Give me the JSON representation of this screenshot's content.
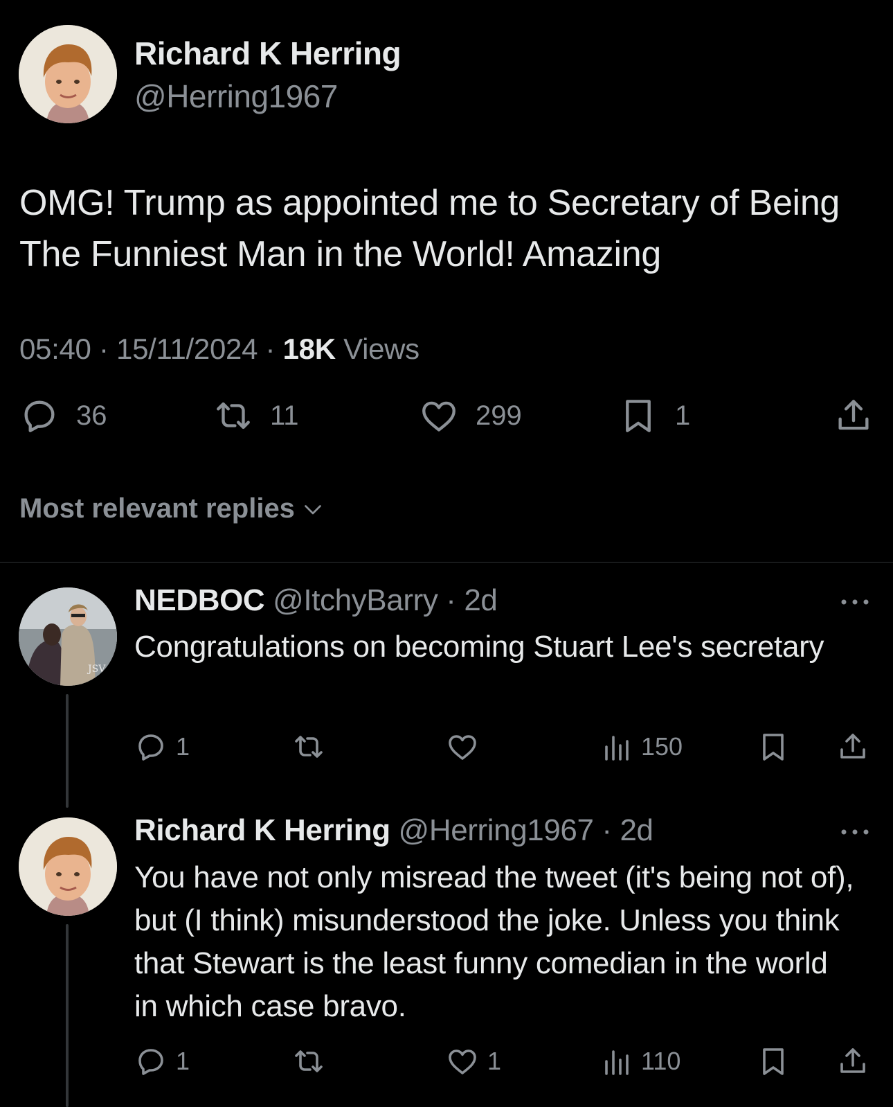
{
  "main_tweet": {
    "author_name": "Richard K Herring",
    "author_handle": "@Herring1967",
    "text": "OMG! Trump as appointed me to Secretary of Being The Funniest Man in the World! Amazing",
    "time": "05:40",
    "date": "15/11/2024",
    "views_count": "18K",
    "views_label": "Views",
    "replies": "36",
    "reposts": "11",
    "likes": "299",
    "bookmarks": "1"
  },
  "sort": {
    "label": "Most relevant replies"
  },
  "replies": [
    {
      "author_name": "NEDBOC",
      "author_handle": "@ItchyBarry",
      "age": "2d",
      "text": "Congratulations on becoming Stuart Lee's secretary",
      "replies": "1",
      "reposts": "",
      "likes": "",
      "views": "150"
    },
    {
      "author_name": "Richard K Herring",
      "author_handle": "@Herring1967",
      "age": "2d",
      "text": "You have not only misread the tweet (it's being not of), but (I think) misunderstood the joke. Unless you think that Stewart is the least funny comedian in the world in which case bravo.",
      "replies": "1",
      "reposts": "",
      "likes": "1",
      "views": "110"
    }
  ],
  "icons": {
    "reply": "reply-icon",
    "repost": "repost-icon",
    "like": "heart-icon",
    "bookmark": "bookmark-icon",
    "share": "share-icon",
    "views": "views-icon",
    "more": "more-icon",
    "sort": "chevron-down-icon"
  },
  "colors": {
    "background": "#000000",
    "text": "#e7e9ea",
    "muted": "#8b9096",
    "divider": "#2f3336"
  }
}
